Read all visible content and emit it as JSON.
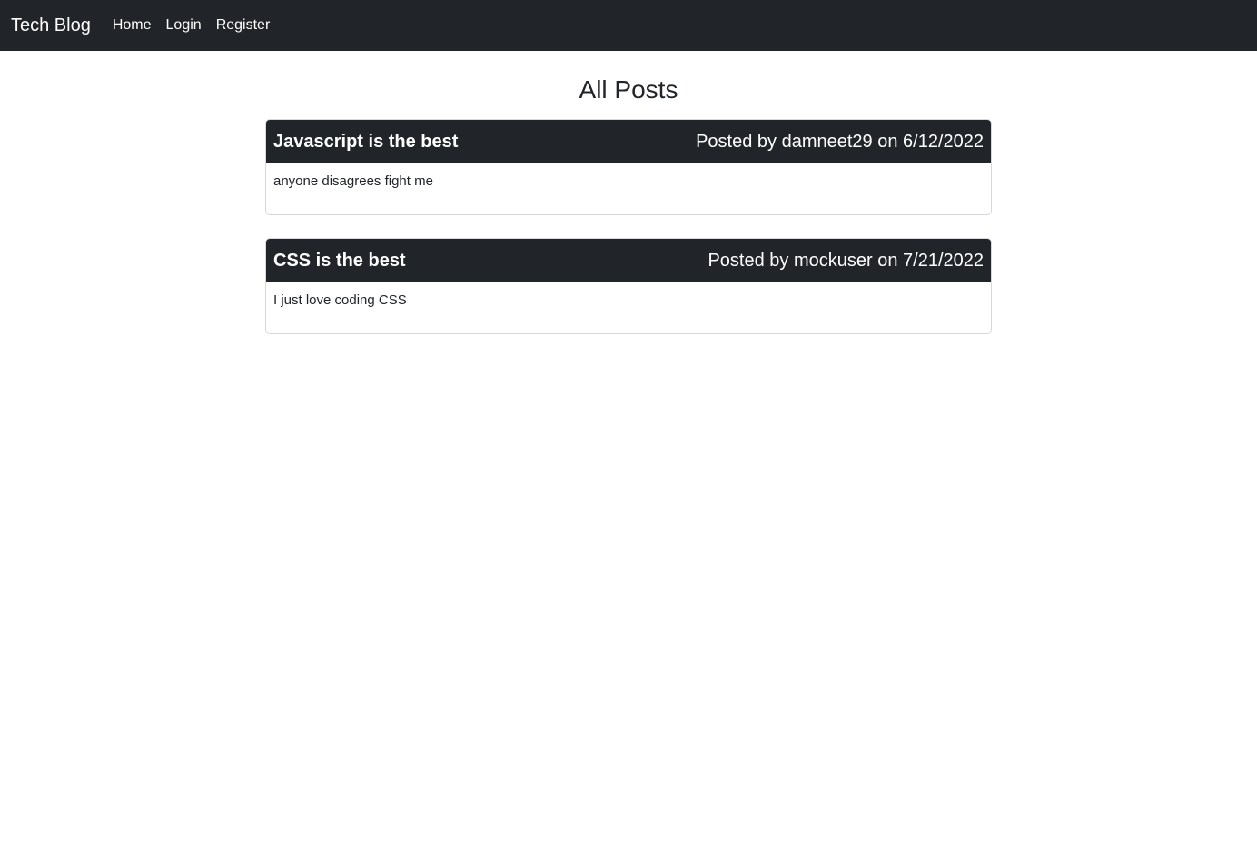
{
  "navbar": {
    "brand": "Tech Blog",
    "links": [
      "Home",
      "Login",
      "Register"
    ]
  },
  "main": {
    "title": "All Posts",
    "posts": [
      {
        "title": "Javascript is the best",
        "meta": "Posted by damneet29 on 6/12/2022",
        "body": "anyone disagrees fight me"
      },
      {
        "title": "CSS is the best",
        "meta": "Posted by mockuser on 7/21/2022",
        "body": "I just love coding CSS"
      }
    ]
  }
}
